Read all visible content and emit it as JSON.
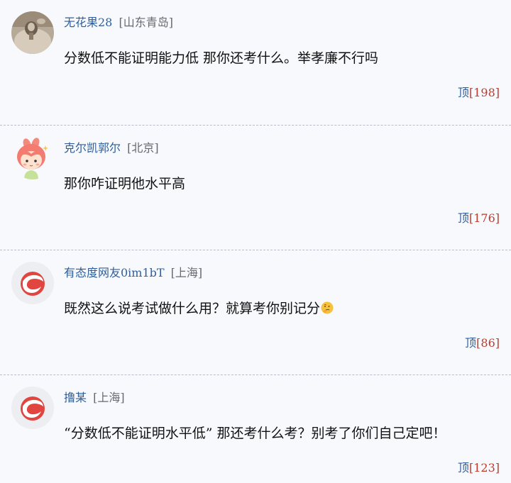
{
  "comments": [
    {
      "username": "无花果28",
      "location": "[山东青岛]",
      "text": "分数低不能证明能力低 那你还考什么。举孝廉不行吗",
      "vote_label": "顶",
      "vote_count": "[198]",
      "avatar": "photo-avatar"
    },
    {
      "username": "克尔凯郭尔",
      "location": "[北京]",
      "text": "那你咋证明他水平高",
      "vote_label": "顶",
      "vote_count": "[176]",
      "avatar": "cartoon-girl-avatar"
    },
    {
      "username": "有态度网友0im1bT",
      "location": "[上海]",
      "text": "既然这么说考试做什么用？就算考你别记分",
      "emoji": "thinking-face-emoji",
      "vote_label": "顶",
      "vote_count": "[86]",
      "avatar": "default-logo-avatar"
    },
    {
      "username": "撸某",
      "location": "[上海]",
      "text": "“分数低不能证明水平低” 那还考什么考？别考了你们自己定吧！",
      "vote_label": "顶",
      "vote_count": "[123]",
      "avatar": "default-logo-avatar"
    }
  ],
  "colors": {
    "background": "#f7f9fd",
    "username": "#2f5e9a",
    "vote_count": "#c0392b",
    "logo_red": "#e0463f"
  }
}
